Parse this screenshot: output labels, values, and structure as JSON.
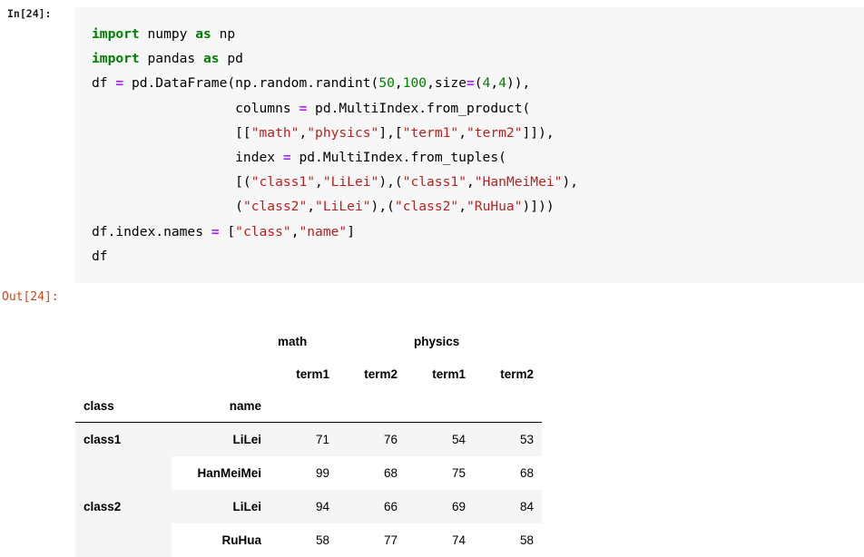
{
  "cell": {
    "input_prompt": "In[24]:",
    "output_prompt": "Out[24]:",
    "code_lines": [
      "import numpy as np",
      "import pandas as pd",
      "df = pd.DataFrame(np.random.randint(50,100,size=(4,4)),",
      "                  columns = pd.MultiIndex.from_product(",
      "                  [[\"math\",\"physics\"],[\"term1\",\"term2\"]]),",
      "                  index = pd.MultiIndex.from_tuples(",
      "                  [(\"class1\",\"LiLei\"),(\"class1\",\"HanMeiMei\"),",
      "                  (\"class2\",\"LiLei\"),(\"class2\",\"RuHua\")]))",
      "df.index.names = [\"class\",\"name\"]",
      "df"
    ],
    "code_tokens": {
      "line0": [
        "import",
        "numpy",
        "as",
        "np"
      ],
      "line1": [
        "import",
        "pandas",
        "as",
        "pd"
      ],
      "numbers": [
        "50",
        "100",
        "4",
        "4"
      ],
      "strings": [
        "math",
        "physics",
        "term1",
        "term2",
        "class1",
        "LiLei",
        "class1",
        "HanMeiMei",
        "class2",
        "LiLei",
        "class2",
        "RuHua",
        "class",
        "name"
      ],
      "operators": [
        "=",
        "=",
        "=",
        "=",
        "="
      ]
    }
  },
  "colors": {
    "keyword": "#008000",
    "string": "#ba2121",
    "number": "#008000",
    "operator": "#aa22ff",
    "out_prompt": "#d84315",
    "code_background": "#f7f7f7",
    "row_shade": "#f5f5f5"
  },
  "chart_data": {
    "type": "table",
    "title": "",
    "column_group_header": [
      "math",
      "physics"
    ],
    "column_sub_header": [
      "term1",
      "term2",
      "term1",
      "term2"
    ],
    "index_names": [
      "class",
      "name"
    ],
    "columns": [
      {
        "group": "math",
        "sub": "term1"
      },
      {
        "group": "math",
        "sub": "term2"
      },
      {
        "group": "physics",
        "sub": "term1"
      },
      {
        "group": "physics",
        "sub": "term2"
      }
    ],
    "rows": [
      {
        "class": "class1",
        "name": "LiLei",
        "values": [
          71,
          76,
          54,
          53
        ],
        "shaded": true
      },
      {
        "class": "",
        "name": "HanMeiMei",
        "values": [
          99,
          68,
          75,
          68
        ],
        "shaded": false
      },
      {
        "class": "class2",
        "name": "LiLei",
        "values": [
          94,
          66,
          69,
          84
        ],
        "shaded": true
      },
      {
        "class": "",
        "name": "RuHua",
        "values": [
          58,
          77,
          74,
          58
        ],
        "shaded": false
      }
    ]
  },
  "table": {
    "group_math": "math",
    "group_physics": "physics",
    "sub_0": "term1",
    "sub_1": "term2",
    "sub_2": "term1",
    "sub_3": "term2",
    "index_name_class": "class",
    "index_name_name": "name",
    "r0_class": "class1",
    "r0_name": "LiLei",
    "r0_v0": "71",
    "r0_v1": "76",
    "r0_v2": "54",
    "r0_v3": "53",
    "r1_class": "",
    "r1_name": "HanMeiMei",
    "r1_v0": "99",
    "r1_v1": "68",
    "r1_v2": "75",
    "r1_v3": "68",
    "r2_class": "class2",
    "r2_name": "LiLei",
    "r2_v0": "94",
    "r2_v1": "66",
    "r2_v2": "69",
    "r2_v3": "84",
    "r3_class": "",
    "r3_name": "RuHua",
    "r3_v0": "58",
    "r3_v1": "77",
    "r3_v2": "74",
    "r3_v3": "58"
  }
}
